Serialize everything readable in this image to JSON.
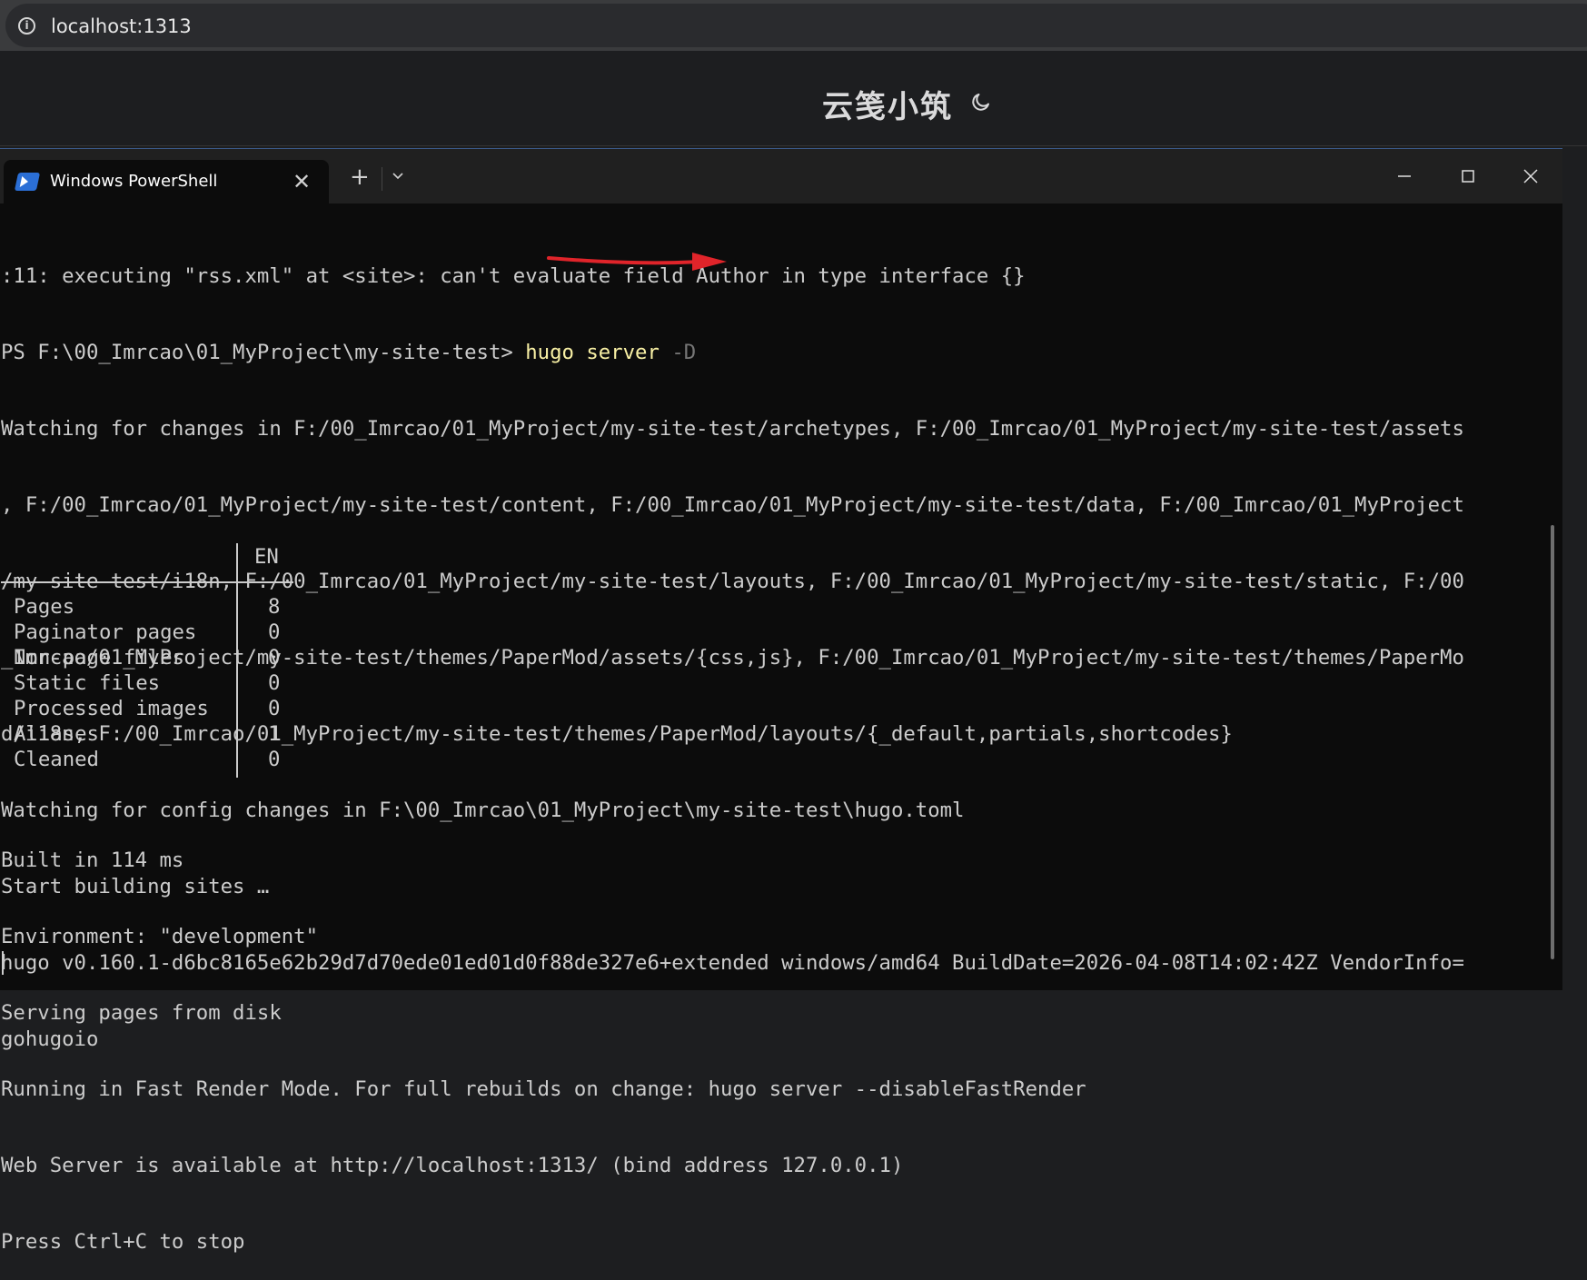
{
  "browser": {
    "url": "localhost:1313"
  },
  "site": {
    "title": "云笺小筑"
  },
  "terminal": {
    "tab_title": "Windows PowerShell",
    "tab_close": "✕",
    "new_tab": "+",
    "lines_top": [
      ":11: executing \"rss.xml\" at <site>: can't evaluate field Author in type interface {}"
    ],
    "prompt": {
      "prefix": "PS F:\\00_Imrcao\\01_MyProject\\my-site-test> ",
      "cmd": "hugo server",
      "cmd_space": " ",
      "flag": "-D"
    },
    "lines_watch": [
      "Watching for changes in F:/00_Imrcao/01_MyProject/my-site-test/archetypes, F:/00_Imrcao/01_MyProject/my-site-test/assets",
      ", F:/00_Imrcao/01_MyProject/my-site-test/content, F:/00_Imrcao/01_MyProject/my-site-test/data, F:/00_Imrcao/01_MyProject",
      "/my-site-test/i18n, F:/00_Imrcao/01_MyProject/my-site-test/layouts, F:/00_Imrcao/01_MyProject/my-site-test/static, F:/00",
      "_Imrcao/01_MyProject/my-site-test/themes/PaperMod/assets/{css,js}, F:/00_Imrcao/01_MyProject/my-site-test/themes/PaperMo",
      "d/i18n, F:/00_Imrcao/01_MyProject/my-site-test/themes/PaperMod/layouts/{_default,partials,shortcodes}",
      "Watching for config changes in F:\\00_Imrcao\\01_MyProject\\my-site-test\\hugo.toml",
      "Start building sites …",
      "hugo v0.160.1-d6bc8165e62b29d7d70ede01ed01d0f88de327e6+extended windows/amd64 BuildDate=2026-04-08T14:02:42Z VendorInfo=",
      "gohugoio"
    ],
    "table": {
      "header": "EN",
      "rows": [
        {
          "label": "Pages",
          "value": "8"
        },
        {
          "label": "Paginator pages",
          "value": "0"
        },
        {
          "label": "Non-page files",
          "value": "0"
        },
        {
          "label": "Static files",
          "value": "0"
        },
        {
          "label": "Processed images",
          "value": "0"
        },
        {
          "label": "Aliases",
          "value": "1"
        },
        {
          "label": "Cleaned",
          "value": "0"
        }
      ]
    },
    "lines_bottom": [
      "Built in 114 ms",
      "Environment: \"development\"",
      "Serving pages from disk",
      "Running in Fast Render Mode. For full rebuilds on change: hugo server --disableFastRender",
      "Web Server is available at http://localhost:1313/ (bind address 127.0.0.1)",
      "Press Ctrl+C to stop"
    ]
  },
  "colors": {
    "terminal_bg": "#0c0c0c",
    "terminal_fg": "#cccccc",
    "command_highlight": "#f9f1a5",
    "arrow_red": "#e0242a",
    "ps_icon_blue": "#2b6fd6"
  },
  "icons": [
    "site-info-icon",
    "moon-icon",
    "powershell-icon",
    "close-icon",
    "plus-icon",
    "chevron-down-icon",
    "minimize-icon",
    "maximize-icon",
    "window-close-icon"
  ]
}
